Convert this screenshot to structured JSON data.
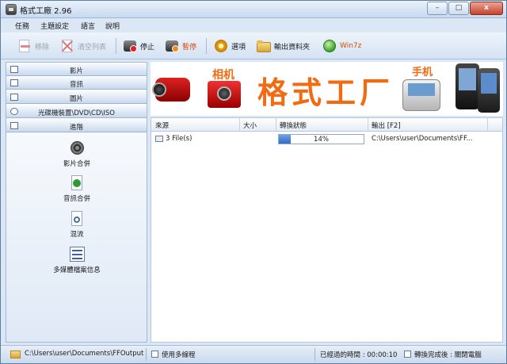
{
  "window": {
    "title": "格式工廠 2.96",
    "controls": {
      "minimize": "–",
      "maximize": "□",
      "close": "x"
    }
  },
  "menu": [
    "任務",
    "主題設定",
    "語言",
    "說明"
  ],
  "toolbar": {
    "remove": "移除",
    "clear_list": "清空列表",
    "stop": "停止",
    "pause": "暫停",
    "options": "選項",
    "output_folder": "輸出資料夾",
    "win7z": "Win7z"
  },
  "sidebar": {
    "categories": [
      "影片",
      "音訊",
      "圖片",
      "光碟機裝置\\DVD\\CD\\ISO",
      "進階"
    ],
    "tools": [
      "影片合併",
      "音訊合併",
      "混流",
      "多媒體檔案信息"
    ]
  },
  "banner": {
    "title": "格式工厂",
    "camera_label": "相机",
    "phone_label": "手机"
  },
  "table": {
    "headers": [
      "來源",
      "大小",
      "轉換狀態",
      "輸出 [F2]"
    ],
    "rows": [
      {
        "source": "3 File(s)",
        "size": "",
        "progress": 0.14,
        "progress_text": "14%",
        "output": "C:\\Users\\user\\Documents\\FF..."
      }
    ]
  },
  "statusbar": {
    "output_path": "C:\\Users\\user\\Documents\\FFOutput",
    "multithread": "使用多線程",
    "elapsed": "已經過的時間 : 00:00:10",
    "after_done": "轉換完成後 : 關閉電腦"
  },
  "colors": {
    "accent": "#f26a12",
    "progress": "#2f6cc8"
  }
}
